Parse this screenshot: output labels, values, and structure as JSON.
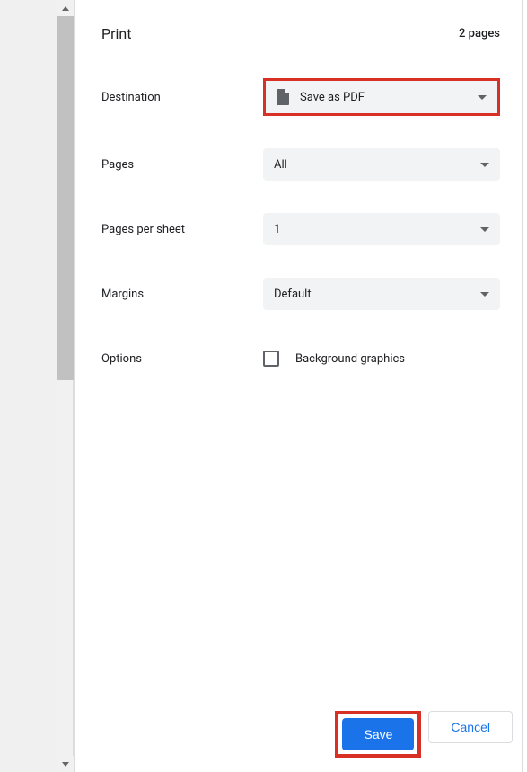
{
  "header": {
    "title": "Print",
    "page_count": "2 pages"
  },
  "fields": {
    "destination": {
      "label": "Destination",
      "value": "Save as PDF"
    },
    "pages": {
      "label": "Pages",
      "value": "All"
    },
    "pages_per_sheet": {
      "label": "Pages per sheet",
      "value": "1"
    },
    "margins": {
      "label": "Margins",
      "value": "Default"
    },
    "options": {
      "label": "Options",
      "checkbox_label": "Background graphics"
    }
  },
  "buttons": {
    "save": "Save",
    "cancel": "Cancel"
  }
}
